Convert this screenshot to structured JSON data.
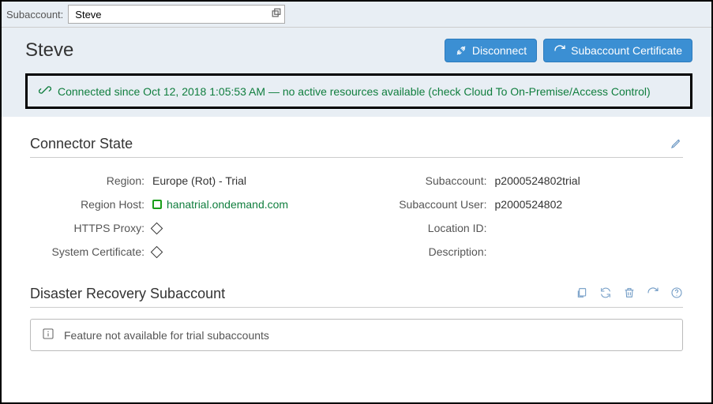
{
  "topbar": {
    "label": "Subaccount:",
    "value": "Steve"
  },
  "header": {
    "title": "Steve",
    "disconnect_label": "Disconnect",
    "cert_label": "Subaccount Certificate"
  },
  "status": {
    "text": "Connected since Oct 12, 2018 1:05:53 AM — no active resources available (check Cloud To On-Premise/Access Control)"
  },
  "connector_state": {
    "title": "Connector State",
    "left": {
      "region_label": "Region:",
      "region_value": "Europe (Rot) - Trial",
      "region_host_label": "Region Host:",
      "region_host_value": "hanatrial.ondemand.com",
      "https_proxy_label": "HTTPS Proxy:",
      "sys_cert_label": "System Certificate:"
    },
    "right": {
      "subaccount_label": "Subaccount:",
      "subaccount_value": "p2000524802trial",
      "subaccount_user_label": "Subaccount User:",
      "subaccount_user_value": "p2000524802",
      "location_id_label": "Location ID:",
      "description_label": "Description:"
    }
  },
  "disaster_recovery": {
    "title": "Disaster Recovery Subaccount",
    "info_text": "Feature not available for trial subaccounts"
  }
}
